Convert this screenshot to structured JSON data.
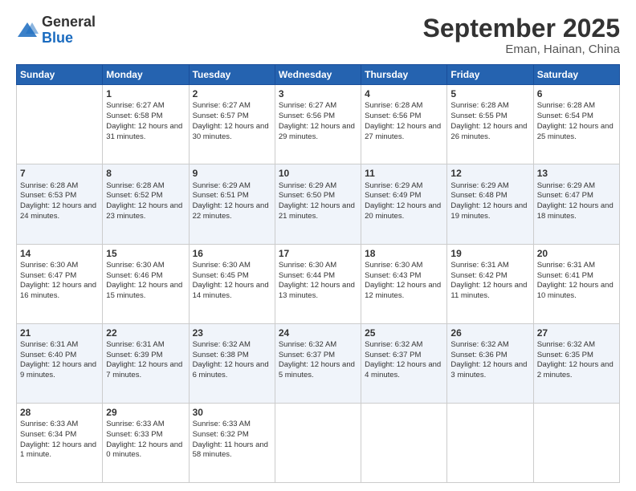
{
  "header": {
    "logo_general": "General",
    "logo_blue": "Blue",
    "month_title": "September 2025",
    "subtitle": "Eman, Hainan, China"
  },
  "weekdays": [
    "Sunday",
    "Monday",
    "Tuesday",
    "Wednesday",
    "Thursday",
    "Friday",
    "Saturday"
  ],
  "weeks": [
    [
      {
        "day": "",
        "sunrise": "",
        "sunset": "",
        "daylight": ""
      },
      {
        "day": "1",
        "sunrise": "Sunrise: 6:27 AM",
        "sunset": "Sunset: 6:58 PM",
        "daylight": "Daylight: 12 hours and 31 minutes."
      },
      {
        "day": "2",
        "sunrise": "Sunrise: 6:27 AM",
        "sunset": "Sunset: 6:57 PM",
        "daylight": "Daylight: 12 hours and 30 minutes."
      },
      {
        "day": "3",
        "sunrise": "Sunrise: 6:27 AM",
        "sunset": "Sunset: 6:56 PM",
        "daylight": "Daylight: 12 hours and 29 minutes."
      },
      {
        "day": "4",
        "sunrise": "Sunrise: 6:28 AM",
        "sunset": "Sunset: 6:56 PM",
        "daylight": "Daylight: 12 hours and 27 minutes."
      },
      {
        "day": "5",
        "sunrise": "Sunrise: 6:28 AM",
        "sunset": "Sunset: 6:55 PM",
        "daylight": "Daylight: 12 hours and 26 minutes."
      },
      {
        "day": "6",
        "sunrise": "Sunrise: 6:28 AM",
        "sunset": "Sunset: 6:54 PM",
        "daylight": "Daylight: 12 hours and 25 minutes."
      }
    ],
    [
      {
        "day": "7",
        "sunrise": "Sunrise: 6:28 AM",
        "sunset": "Sunset: 6:53 PM",
        "daylight": "Daylight: 12 hours and 24 minutes."
      },
      {
        "day": "8",
        "sunrise": "Sunrise: 6:28 AM",
        "sunset": "Sunset: 6:52 PM",
        "daylight": "Daylight: 12 hours and 23 minutes."
      },
      {
        "day": "9",
        "sunrise": "Sunrise: 6:29 AM",
        "sunset": "Sunset: 6:51 PM",
        "daylight": "Daylight: 12 hours and 22 minutes."
      },
      {
        "day": "10",
        "sunrise": "Sunrise: 6:29 AM",
        "sunset": "Sunset: 6:50 PM",
        "daylight": "Daylight: 12 hours and 21 minutes."
      },
      {
        "day": "11",
        "sunrise": "Sunrise: 6:29 AM",
        "sunset": "Sunset: 6:49 PM",
        "daylight": "Daylight: 12 hours and 20 minutes."
      },
      {
        "day": "12",
        "sunrise": "Sunrise: 6:29 AM",
        "sunset": "Sunset: 6:48 PM",
        "daylight": "Daylight: 12 hours and 19 minutes."
      },
      {
        "day": "13",
        "sunrise": "Sunrise: 6:29 AM",
        "sunset": "Sunset: 6:47 PM",
        "daylight": "Daylight: 12 hours and 18 minutes."
      }
    ],
    [
      {
        "day": "14",
        "sunrise": "Sunrise: 6:30 AM",
        "sunset": "Sunset: 6:47 PM",
        "daylight": "Daylight: 12 hours and 16 minutes."
      },
      {
        "day": "15",
        "sunrise": "Sunrise: 6:30 AM",
        "sunset": "Sunset: 6:46 PM",
        "daylight": "Daylight: 12 hours and 15 minutes."
      },
      {
        "day": "16",
        "sunrise": "Sunrise: 6:30 AM",
        "sunset": "Sunset: 6:45 PM",
        "daylight": "Daylight: 12 hours and 14 minutes."
      },
      {
        "day": "17",
        "sunrise": "Sunrise: 6:30 AM",
        "sunset": "Sunset: 6:44 PM",
        "daylight": "Daylight: 12 hours and 13 minutes."
      },
      {
        "day": "18",
        "sunrise": "Sunrise: 6:30 AM",
        "sunset": "Sunset: 6:43 PM",
        "daylight": "Daylight: 12 hours and 12 minutes."
      },
      {
        "day": "19",
        "sunrise": "Sunrise: 6:31 AM",
        "sunset": "Sunset: 6:42 PM",
        "daylight": "Daylight: 12 hours and 11 minutes."
      },
      {
        "day": "20",
        "sunrise": "Sunrise: 6:31 AM",
        "sunset": "Sunset: 6:41 PM",
        "daylight": "Daylight: 12 hours and 10 minutes."
      }
    ],
    [
      {
        "day": "21",
        "sunrise": "Sunrise: 6:31 AM",
        "sunset": "Sunset: 6:40 PM",
        "daylight": "Daylight: 12 hours and 9 minutes."
      },
      {
        "day": "22",
        "sunrise": "Sunrise: 6:31 AM",
        "sunset": "Sunset: 6:39 PM",
        "daylight": "Daylight: 12 hours and 7 minutes."
      },
      {
        "day": "23",
        "sunrise": "Sunrise: 6:32 AM",
        "sunset": "Sunset: 6:38 PM",
        "daylight": "Daylight: 12 hours and 6 minutes."
      },
      {
        "day": "24",
        "sunrise": "Sunrise: 6:32 AM",
        "sunset": "Sunset: 6:37 PM",
        "daylight": "Daylight: 12 hours and 5 minutes."
      },
      {
        "day": "25",
        "sunrise": "Sunrise: 6:32 AM",
        "sunset": "Sunset: 6:37 PM",
        "daylight": "Daylight: 12 hours and 4 minutes."
      },
      {
        "day": "26",
        "sunrise": "Sunrise: 6:32 AM",
        "sunset": "Sunset: 6:36 PM",
        "daylight": "Daylight: 12 hours and 3 minutes."
      },
      {
        "day": "27",
        "sunrise": "Sunrise: 6:32 AM",
        "sunset": "Sunset: 6:35 PM",
        "daylight": "Daylight: 12 hours and 2 minutes."
      }
    ],
    [
      {
        "day": "28",
        "sunrise": "Sunrise: 6:33 AM",
        "sunset": "Sunset: 6:34 PM",
        "daylight": "Daylight: 12 hours and 1 minute."
      },
      {
        "day": "29",
        "sunrise": "Sunrise: 6:33 AM",
        "sunset": "Sunset: 6:33 PM",
        "daylight": "Daylight: 12 hours and 0 minutes."
      },
      {
        "day": "30",
        "sunrise": "Sunrise: 6:33 AM",
        "sunset": "Sunset: 6:32 PM",
        "daylight": "Daylight: 11 hours and 58 minutes."
      },
      {
        "day": "",
        "sunrise": "",
        "sunset": "",
        "daylight": ""
      },
      {
        "day": "",
        "sunrise": "",
        "sunset": "",
        "daylight": ""
      },
      {
        "day": "",
        "sunrise": "",
        "sunset": "",
        "daylight": ""
      },
      {
        "day": "",
        "sunrise": "",
        "sunset": "",
        "daylight": ""
      }
    ]
  ]
}
